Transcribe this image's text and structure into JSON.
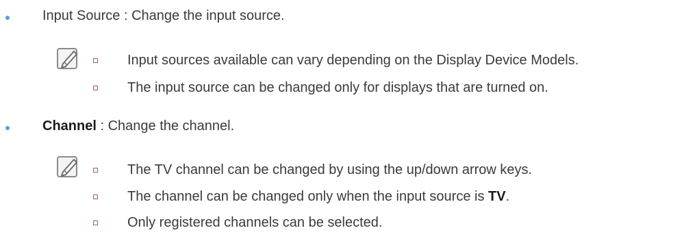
{
  "sections": [
    {
      "term": "Input Source",
      "separator": " : ",
      "description": "Change the input source.",
      "notes": [
        "Input sources available can vary depending on the Display Device Models.",
        "The input source can be changed only for displays that are turned on."
      ]
    },
    {
      "term": "Channel",
      "separator": " : ",
      "description": "Change the channel.",
      "notes": [
        "The TV channel can be changed by using the up/down arrow keys.",
        {
          "before": "The channel can be changed only when the input source is ",
          "bold": "TV",
          "after": "."
        },
        "Only registered channels can be selected."
      ]
    }
  ],
  "icons": {
    "bullet": "bullet-dot-icon",
    "note": "note-pencil-icon",
    "sub_bullet": "square-bullet-icon"
  },
  "colors": {
    "text": "#3a3a3a",
    "bullet": "#5b9bd5",
    "sub_bullet": "#c0504d"
  }
}
